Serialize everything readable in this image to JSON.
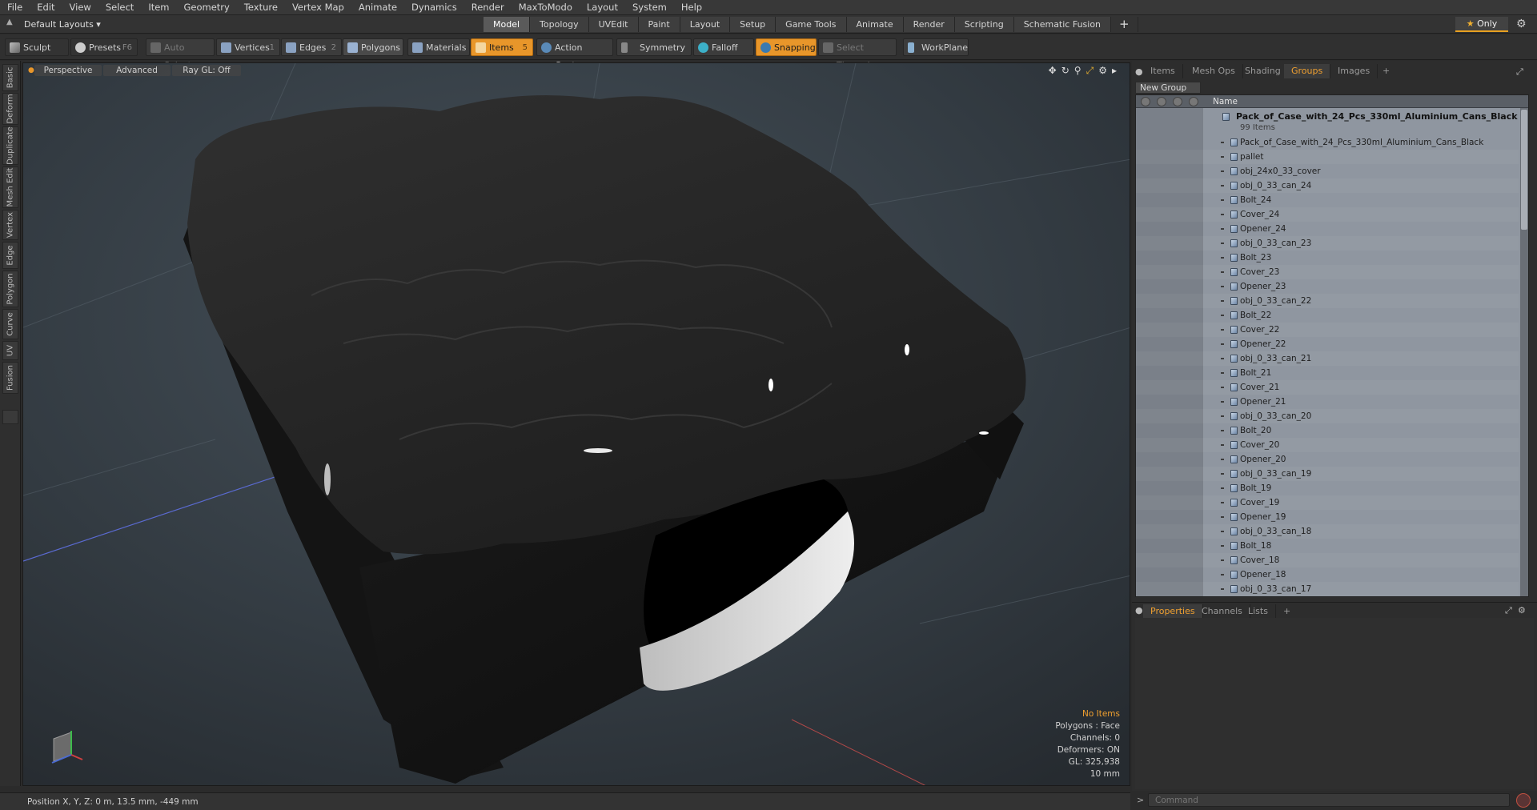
{
  "menu": [
    "File",
    "Edit",
    "View",
    "Select",
    "Item",
    "Geometry",
    "Texture",
    "Vertex Map",
    "Animate",
    "Dynamics",
    "Render",
    "MaxToModo",
    "Layout",
    "System",
    "Help"
  ],
  "layout_select": "Default Layouts ▾",
  "mode_tabs": [
    {
      "label": "Model",
      "active": true
    },
    {
      "label": "Topology"
    },
    {
      "label": "UVEdit"
    },
    {
      "label": "Paint"
    },
    {
      "label": "Layout"
    },
    {
      "label": "Setup"
    },
    {
      "label": "Game Tools"
    },
    {
      "label": "Animate"
    },
    {
      "label": "Render"
    },
    {
      "label": "Scripting"
    },
    {
      "label": "Schematic Fusion"
    }
  ],
  "mode_plus": "+",
  "only_label": "Only",
  "toolbar": {
    "sculpt": "Sculpt",
    "presets": "Presets",
    "presets_key": "F6",
    "auto_select": "Auto Select",
    "vertices": "Vertices",
    "vertices_count": "1",
    "edges": "Edges",
    "edges_count": "2",
    "polygons": "Polygons",
    "materials": "Materials",
    "items": "Items",
    "items_count": "5",
    "action_center": "Action Center",
    "symmetry": "Symmetry",
    "falloff": "Falloff",
    "snapping": "Snapping",
    "select_through": "Select Through",
    "workplane": "WorkPlane"
  },
  "left_tabs": [
    "Basic",
    "Deform",
    "Duplicate",
    "Mesh Edit",
    "Vertex",
    "Edge",
    "Polygon",
    "Curve",
    "UV",
    "Fusion"
  ],
  "viewport": {
    "perspective": "Perspective",
    "advanced": "Advanced",
    "raygl": "Ray GL: Off",
    "stats": {
      "no_items": "No Items",
      "polygons": "Polygons : Face",
      "channels": "Channels: 0",
      "deformers": "Deformers: ON",
      "gl": "GL: 325,938",
      "scale": "10 mm"
    }
  },
  "status": {
    "position": "Position X, Y, Z:  0 m, 13.5 mm, -449 mm"
  },
  "right_tabs": [
    "Items",
    "Mesh Ops",
    "Shading",
    "Groups",
    "Images"
  ],
  "right_active": "Groups",
  "new_group": "New Group",
  "tree": {
    "name_header": "Name",
    "root": "Pack_of_Case_with_24_Pcs_330ml_Aluminium_Cans_Black",
    "root_count": "99 Items",
    "items": [
      "Pack_of_Case_with_24_Pcs_330ml_Aluminium_Cans_Black",
      "pallet",
      "obj_24x0_33_cover",
      "obj_0_33_can_24",
      "Bolt_24",
      "Cover_24",
      "Opener_24",
      "obj_0_33_can_23",
      "Bolt_23",
      "Cover_23",
      "Opener_23",
      "obj_0_33_can_22",
      "Bolt_22",
      "Cover_22",
      "Opener_22",
      "obj_0_33_can_21",
      "Bolt_21",
      "Cover_21",
      "Opener_21",
      "obj_0_33_can_20",
      "Bolt_20",
      "Cover_20",
      "Opener_20",
      "obj_0_33_can_19",
      "Bolt_19",
      "Cover_19",
      "Opener_19",
      "obj_0_33_can_18",
      "Bolt_18",
      "Cover_18",
      "Opener_18",
      "obj_0_33_can_17"
    ]
  },
  "bottom_tabs": [
    "Properties",
    "Channels",
    "Lists"
  ],
  "bottom_active": "Properties",
  "command_placeholder": "Command",
  "colors": {
    "accent": "#e8962a",
    "panel": "#2d2d2d",
    "tree_bg": "#8f96a0"
  }
}
